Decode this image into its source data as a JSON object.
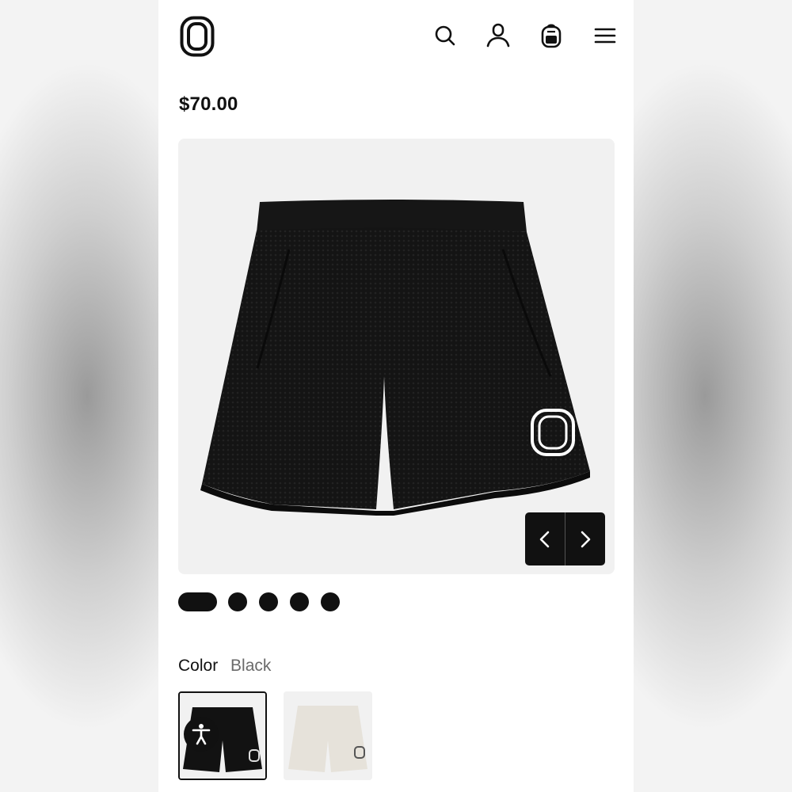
{
  "header": {
    "logo_icon": "brand-o-logo",
    "icons": [
      "search-icon",
      "account-icon",
      "backpack-cart-icon",
      "menu-icon"
    ]
  },
  "product": {
    "price": "$70.00",
    "image_subject": "black mesh shorts",
    "gallery_nav": {
      "prev_icon": "chevron-left-icon",
      "next_icon": "chevron-right-icon"
    },
    "gallery_dots": {
      "total": 5,
      "active_index": 0
    }
  },
  "options": {
    "color_label": "Color",
    "color_value": "Black",
    "swatches": [
      {
        "name": "Black",
        "color": "#111111",
        "selected": true
      },
      {
        "name": "Cream",
        "color": "#e6e2da",
        "selected": false
      }
    ]
  },
  "accessibility": {
    "icon": "accessibility-icon"
  },
  "colors": {
    "text": "#111111",
    "muted": "#6a6a6a",
    "gallery_bg": "#f1f1f1"
  }
}
